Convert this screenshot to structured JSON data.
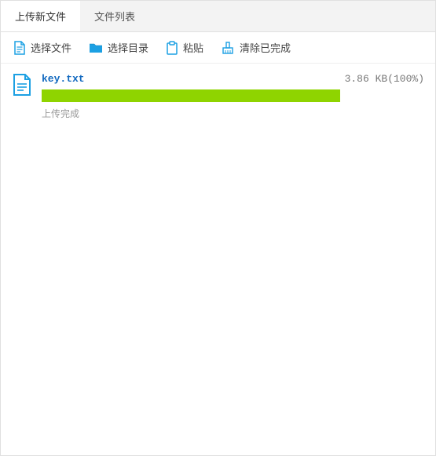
{
  "tabs": {
    "upload": "上传新文件",
    "list": "文件列表",
    "active": "upload"
  },
  "toolbar": {
    "select_file": "选择文件",
    "select_folder": "选择目录",
    "paste": "粘贴",
    "clear_done": "清除已完成"
  },
  "file": {
    "name": "key.txt",
    "size_text": "3.86 KB",
    "percent_text": "(100%)",
    "percent": 100,
    "status": "上传完成"
  },
  "colors": {
    "accent": "#1ca0e3",
    "progress": "#8fd400",
    "link": "#1068bf"
  }
}
